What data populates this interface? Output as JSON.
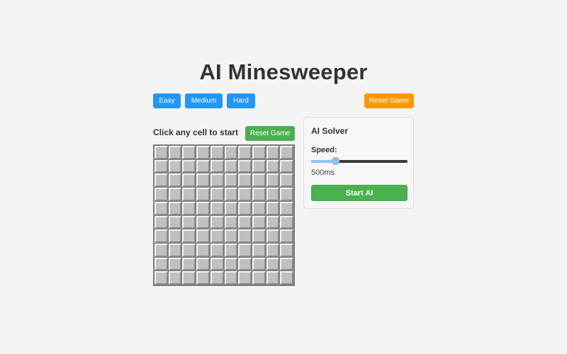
{
  "title": "AI Minesweeper",
  "difficulty": {
    "easy_label": "Easy",
    "medium_label": "Medium",
    "hard_label": "Hard"
  },
  "top_reset_label": "Reset Game",
  "game": {
    "status": "Click any cell to start",
    "reset_label": "Reset Game",
    "rows": 10,
    "cols": 10
  },
  "solver": {
    "title": "AI Solver",
    "speed_label": "Speed:",
    "speed_value": "500ms",
    "speed_fraction": 0.25,
    "start_label": "Start AI"
  },
  "colors": {
    "blue": "#2196f3",
    "orange": "#ff9800",
    "green": "#4caf50"
  }
}
